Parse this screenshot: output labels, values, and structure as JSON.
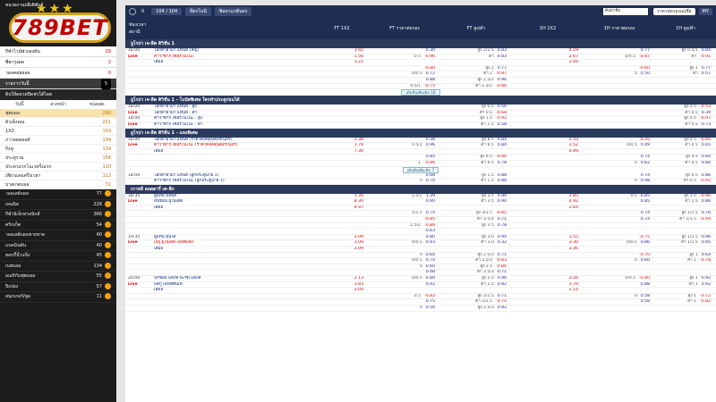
{
  "sidebar": {
    "title": "ทนวดงานปลีเติพันธ์",
    "logo_text": "789BET",
    "top_list": [
      {
        "label": "กีฬาไวน์พ่วงลงทัน",
        "count": "29"
      },
      {
        "label": "พี่พารุ่งดด",
        "count": "2"
      },
      {
        "label": "วอลคดุ่ยยอด",
        "count": "0"
      }
    ],
    "active_item": {
      "label": "รายการวันนี้",
      "badge": "5"
    },
    "section_title": "ดิบให้ดดวดปิดฟวได้ไดด",
    "sub_tabs": [
      "วันนี้",
      "ล่วงหน้า",
      "ขนดสด"
    ],
    "sports": [
      {
        "label": "ฟุตบอล",
        "count": "290"
      },
      {
        "label": "ตัวเต็งคุณ",
        "count": "221"
      },
      {
        "label": "1X2",
        "count": "159"
      },
      {
        "label": "ภาวยดดผลต์",
        "count": "134"
      },
      {
        "label": "กิ่งคู่",
        "count": "134"
      },
      {
        "label": "ประตูรวม",
        "count": "156"
      },
      {
        "label": "ประตวแรกโนเวครั้งแรก",
        "count": "110"
      },
      {
        "label": "เพียวแลนครึ่งเวลา",
        "count": "112"
      },
      {
        "label": "บาสเกตบอล",
        "count": "72"
      }
    ],
    "dark_sports": [
      {
        "label": "วอลเลย์บอล",
        "count": "77"
      },
      {
        "label": "เทนนิส",
        "count": "226"
      },
      {
        "label": "กีฬาอิเล็กทรอนิกส์",
        "count": "366"
      },
      {
        "label": "คริกเก็ต",
        "count": "54"
      },
      {
        "label": "วอลเลย์บอลชายหาด",
        "count": "40"
      },
      {
        "label": "แบดมินตัน",
        "count": "40"
      },
      {
        "label": "ฮอกกี้น้ำแข็ง",
        "count": "45"
      },
      {
        "label": "เบสบอล",
        "count": "134"
      },
      {
        "label": "อเมริกันฟุตบอล",
        "count": "55"
      },
      {
        "label": "ปิงปอง",
        "count": "57"
      },
      {
        "label": "สนุกเกอร์/พูล",
        "count": "11"
      }
    ]
  },
  "topbar": {
    "count": "0",
    "pager": "104 / 104",
    "sort_btn": "ยี่ตกโนนี",
    "view_btn": "ฟิลดาแกดีนดร",
    "search_placeholder": "ค้นหาทีม",
    "odds_select": "ราคาต่อรองเอเชีย",
    "my": "MY"
  },
  "columns": [
    "ช่องเวลา สถานี",
    "",
    "FT 1X2",
    "FT ราคาต่อรอง",
    "FT สูง/ต่ำ",
    "1H 1X2",
    "1H ราคาต่อรอง",
    "1H สูง/ต่ำ"
  ],
  "leagues": [
    {
      "name": "ยูโรปา เจ-ลีค ดิวิชั่น 1",
      "rows": [
        {
          "t": "18:00",
          "team": "โอกิตายามา แทนที่ (หญ)",
          "red": false,
          "x": "3.92",
          "ft_h": "",
          "ft_v": "0.30",
          "ou_h": "สูง 2/2.5",
          "ou_v": "0.83",
          "h1x": "4.19",
          "h1h_h": "",
          "h1h_v": "0.77",
          "h1ou_h": "สูง 0.5/1",
          "h1ou_v": "0.84"
        },
        {
          "t": "Live",
          "team": "คาวาซากิ เซอร์โนโนะ",
          "red": true,
          "x": "1.56",
          "ft_h": "0.5",
          "ft_v": "-0.96",
          "ou_h": "ต่ำ",
          "ou_v": "0.83",
          "h1x": "2.67",
          "h1h_h": "0/0.5",
          "h1h_v": "-0.87",
          "h1ou_h": "ต่ำ",
          "h1ou_v": "-0.91"
        },
        {
          "t": "",
          "team": "เสมอ",
          "red": false,
          "x": "3.22",
          "ft_h": "",
          "ft_v": "",
          "ou_h": "",
          "ou_v": "",
          "h1x": "2.04",
          "h1h_h": "",
          "h1h_v": "",
          "h1ou_h": "",
          "h1ou_v": ""
        },
        {
          "t": "",
          "team": "",
          "red": false,
          "x": "",
          "ft_h": "",
          "ft_v": "-0.80",
          "ou_h": "สูง 2",
          "ou_v": "0.77",
          "h1x": "",
          "h1h_h": "",
          "h1h_v": "-0.60",
          "h1ou_h": "สูง 1",
          "h1ou_v": "0.77"
        },
        {
          "t": "",
          "team": "",
          "red": false,
          "x": "",
          "ft_h": "0/0.5",
          "ft_v": "0.72",
          "ou_h": "ต่ำ 2",
          "ou_v": "-0.87",
          "h1x": "",
          "h1h_h": "0",
          "h1h_v": "0.50",
          "h1ou_h": "ต่ำ",
          "h1ou_v": "0.57"
        },
        {
          "t": "",
          "team": "",
          "red": false,
          "x": "",
          "ft_h": "",
          "ft_v": "0.88",
          "ou_h": "สูง 1.5/2",
          "ou_v": "0.96",
          "h1x": "",
          "h1h_h": "",
          "h1h_v": "",
          "h1ou_h": "",
          "h1ou_v": ""
        },
        {
          "t": "",
          "team": "",
          "red": false,
          "x": "",
          "ft_h": "0.5/1",
          "ft_v": "-0.75",
          "ou_h": "ต่ำ 1.5/2",
          "ou_v": "-0.86",
          "h1x": "",
          "h1h_h": "",
          "h1h_v": "",
          "h1ou_h": "",
          "h1ou_v": ""
        }
      ],
      "more": "เดิมพันเพิ่มเติม 18"
    },
    {
      "name": "ยูโรปา เจ-ลีค ดิวิชั่น 1 - โบนัสพิเศษ ใครทำประตูก่อนได้",
      "rows": [
        {
          "t": "18:00",
          "team": "โอกิตายามา แทนที่ - สูง",
          "red": false,
          "x": "",
          "ft_h": "",
          "ft_v": "",
          "ou_h": "สูง 0.5",
          "ou_v": "0.56",
          "h1x": "",
          "h1h_h": "",
          "h1h_v": "",
          "h1ou_h": "สูง 0.5",
          "h1ou_v": "-0.53"
        },
        {
          "t": "Live",
          "team": "โอกิตายามา แทนที่ - ต่ำ",
          "red": false,
          "x": "",
          "ft_h": "",
          "ft_v": "",
          "ou_h": "ต่ำ 0.5",
          "ou_v": "-0.68",
          "h1x": "",
          "h1h_h": "",
          "h1h_v": "",
          "h1ou_h": "ต่ำ 0.5",
          "h1ou_v": "0.39"
        },
        {
          "t": "18:00",
          "team": "คาวาซากิ เซอร์โนโนะ - สูง",
          "red": false,
          "x": "",
          "ft_h": "",
          "ft_v": "",
          "ou_h": "สูง 1.5",
          "ou_v": "-0.92",
          "h1x": "",
          "h1h_h": "",
          "h1h_v": "",
          "h1ou_h": "สูง 0.5",
          "h1ou_v": "-0.97"
        },
        {
          "t": "Live",
          "team": "คาวาซากิ เซอร์โนโนะ - ต่ำ",
          "red": false,
          "x": "",
          "ft_h": "",
          "ft_v": "",
          "ou_h": "ต่ำ 1.5",
          "ou_v": "0.58",
          "h1x": "",
          "h1h_h": "",
          "h1h_v": "",
          "h1ou_h": "ต่ำ 0.5",
          "h1ou_v": "0.73"
        }
      ],
      "more": ""
    },
    {
      "name": "ยูโรปา เจ-ลีค ดิวิชั่น 1 - แทงพิเศษ",
      "rows": [
        {
          "t": "18:00",
          "team": "โอกิตายามา แทนที่ (ราคาคอดดุนคอร์เนอร์)",
          "red": false,
          "x": "2.38",
          "ft_h": "",
          "ft_v": "0.38",
          "ou_h": "สูง 8.5",
          "ou_v": "0.84",
          "h1x": "2.33",
          "h1h_h": "",
          "h1h_v": "-0.35",
          "h1ou_h": "สูง 0.5",
          "h1ou_v": "-0.85"
        },
        {
          "t": "Live",
          "team": "คาวาซากิ เซอร์โนโนะ (ราคาคอดดุนคอร์เนอร์)",
          "red": true,
          "x": "1.79",
          "ft_h": "0.5/1",
          "ft_v": "0.96",
          "ou_h": "ต่ำ 8.5",
          "ou_v": "0.84",
          "h1x": "2.52",
          "h1h_h": "0/0.5",
          "h1h_v": "0.49",
          "h1ou_h": "ต่ำ 0.5",
          "h1ou_v": "0.65"
        },
        {
          "t": "",
          "team": "เสมอ",
          "red": false,
          "x": "7.30",
          "ft_h": "",
          "ft_v": "",
          "ou_h": "",
          "ou_v": "",
          "h1x": "4.89",
          "h1h_h": "",
          "h1h_v": "",
          "h1ou_h": "",
          "h1ou_v": ""
        },
        {
          "t": "",
          "team": "",
          "red": false,
          "x": "",
          "ft_h": "",
          "ft_v": "0.85",
          "ou_h": "สูง 8.5",
          "ou_v": "-0.96",
          "h1x": "",
          "h1h_h": "",
          "h1h_v": "0.74",
          "h1ou_h": "สูง 4.5",
          "h1ou_v": "0.84"
        },
        {
          "t": "",
          "team": "",
          "red": false,
          "x": "",
          "ft_h": "1",
          "ft_v": "-0.96",
          "ou_h": "ต่ำ 9.5",
          "ou_v": "0.78",
          "h1x": "",
          "h1h_h": "0",
          "h1h_v": "0.62",
          "h1ou_h": "ต่ำ 4.5",
          "h1ou_v": "0.84"
        }
      ],
      "more": "เดิมพันเพิ่มเติม 7"
    },
    {
      "name": "",
      "rows": [
        {
          "t": "18:00",
          "team": "โอกิตายามา แทนที่ (ลูกประตูนาย 1)",
          "red": false,
          "x": "",
          "ft_h": "",
          "ft_v": "0.68",
          "ou_h": "สูง 1.5",
          "ou_v": "0.88",
          "h1x": "",
          "h1h_h": "",
          "h1h_v": "0.74",
          "h1ou_h": "สูง 0.5",
          "h1ou_v": "0.86"
        },
        {
          "t": "",
          "team": "คาวาซากิ เซอร์โนโนะ (ลูกประตูนาย 1)",
          "red": false,
          "x": "",
          "ft_h": "0",
          "ft_v": "0.70",
          "ou_h": "ต่ำ 1.5",
          "ou_v": "0.88",
          "h1x": "",
          "h1h_h": "0",
          "h1h_v": "0.98",
          "h1ou_h": "ต่ำ 0.5",
          "h1ou_v": "-0.92"
        }
      ],
      "more": ""
    },
    {
      "name": "เกาหลี ลอตตารี่ เค-ลีก",
      "rows": [
        {
          "t": "18:35",
          "team": "ยูแทน มอพส์",
          "red": false,
          "x": "1.34",
          "ft_h": "1.5/2",
          "ft_v": "1.39",
          "ou_h": "สูง 3.5",
          "ou_v": "0.90",
          "h1x": "1.85",
          "h1h_h": "0.5",
          "h1h_v": "0.85",
          "h1ou_h": "สูง 1.5",
          "h1ou_v": "-0.96"
        },
        {
          "t": "Live",
          "team": "อินชอน ยูไนเต็ด",
          "red": false,
          "x": "8.30",
          "ft_h": "",
          "ft_v": "0.90",
          "ou_h": "ต่ำ 3.5",
          "ou_v": "0.90",
          "h1x": "4.92",
          "h1h_h": "",
          "h1h_v": "0.85",
          "h1ou_h": "ต่ำ 1.5",
          "h1ou_v": "0.86"
        },
        {
          "t": "",
          "team": "เสมอ",
          "red": false,
          "x": "4.97",
          "ft_h": "",
          "ft_v": "",
          "ou_h": "",
          "ou_v": "",
          "h1x": "2.64",
          "h1h_h": "",
          "h1h_v": "",
          "h1ou_h": "",
          "h1ou_v": ""
        },
        {
          "t": "",
          "team": "",
          "red": false,
          "x": "",
          "ft_h": "1/1.5",
          "ft_v": "0.74",
          "ou_h": "สูง 3/3.5",
          "ou_v": "-0.85",
          "h1x": "",
          "h1h_h": "",
          "h1h_v": "0.74",
          "h1ou_h": "สูง 1/1.5",
          "h1ou_v": "0.76"
        },
        {
          "t": "",
          "team": "",
          "red": false,
          "x": "",
          "ft_h": "",
          "ft_v": "-0.85",
          "ou_h": "ต่ำ 3.5/4",
          "ou_v": "0.71",
          "h1x": "",
          "h1h_h": "",
          "h1h_v": "0.74",
          "h1ou_h": "ต่ำ 1/1.5",
          "h1ou_v": "-0.94"
        },
        {
          "t": "",
          "team": "",
          "red": false,
          "x": "",
          "ft_h": "1.5/2",
          "ft_v": "-0.89",
          "ou_h": "สูง 3.5",
          "ou_v": "0.78",
          "h1x": "",
          "h1h_h": "",
          "h1h_v": "",
          "h1ou_h": "",
          "h1ou_v": ""
        },
        {
          "t": "",
          "team": "",
          "red": false,
          "x": "",
          "ft_h": "",
          "ft_v": "0.63",
          "ou_h": "",
          "ou_v": "",
          "h1x": "",
          "h1h_h": "",
          "h1h_v": "",
          "h1ou_h": "",
          "h1ou_v": ""
        },
        {
          "t": "19:35",
          "team": "ยูแทน ฮุนได",
          "red": false,
          "x": "3.09",
          "ft_h": "",
          "ft_v": "0.80",
          "ou_h": "สูง 3.0",
          "ou_v": "0.94",
          "h1x": "3.55",
          "h1h_h": "",
          "h1h_v": "-0.75",
          "h1ou_h": "สูง 1/1.5",
          "h1ou_v": "0.96"
        },
        {
          "t": "Live",
          "team": "เจจู ยูไนเต็ด เอฟซีแดง",
          "red": true,
          "x": "3.09",
          "ft_h": "0/0.5",
          "ft_v": "0.93",
          "ou_h": "ต่ำ 3.0",
          "ou_v": "0.32",
          "h1x": "3.30",
          "h1h_h": "0/0.5",
          "h1h_v": "0.86",
          "h1ou_h": "ต่ำ 1/1.5",
          "h1ou_v": "0.85"
        },
        {
          "t": "",
          "team": "เสมอ",
          "red": false,
          "x": "3.09",
          "ft_h": "",
          "ft_v": "",
          "ou_h": "",
          "ou_v": "",
          "h1x": "2.36",
          "h1h_h": "",
          "h1h_v": "",
          "h1ou_h": "",
          "h1ou_v": ""
        },
        {
          "t": "",
          "team": "",
          "red": false,
          "x": "",
          "ft_h": "0",
          "ft_v": "0.60",
          "ou_h": "สูง 2.5/3",
          "ou_v": "0.71",
          "h1x": "",
          "h1h_h": "",
          "h1h_v": "-0.70",
          "h1ou_h": "สูง 1",
          "h1ou_v": "0.64"
        },
        {
          "t": "",
          "team": "",
          "red": false,
          "x": "",
          "ft_h": "0/0.5",
          "ft_v": "0.74",
          "ou_h": "ต่ำ 2.5/3",
          "ou_v": "-0.83",
          "h1x": "",
          "h1h_h": "0",
          "h1h_v": "0.60",
          "h1ou_h": "ต่ำ 1",
          "h1ou_v": "-0.78"
        },
        {
          "t": "",
          "team": "",
          "red": false,
          "x": "",
          "ft_h": "0",
          "ft_v": "0.60",
          "ou_h": "สูง 2.5",
          "ou_v": "-0.86",
          "h1x": "",
          "h1h_h": "",
          "h1h_v": "",
          "h1ou_h": "",
          "h1ou_v": ""
        },
        {
          "t": "",
          "team": "",
          "red": false,
          "x": "",
          "ft_h": "",
          "ft_v": "0.48",
          "ou_h": "ต่ำ 3.5/3",
          "ou_v": "0.71",
          "h1x": "",
          "h1h_h": "",
          "h1h_v": "",
          "h1ou_h": "",
          "h1ou_v": ""
        },
        {
          "t": "20:00",
          "team": "ปีกซอม แดงที่ พะรัด แดงที่",
          "red": false,
          "x": "2.13",
          "ft_h": "0/0.5",
          "ft_v": "0.80",
          "ou_h": "สูง 2.5",
          "ou_v": "0.96",
          "h1x": "2.56",
          "h1h_h": "0/0.5",
          "h1h_v": "-0.80",
          "h1ou_h": "สูง 1",
          "h1ou_v": "0.92"
        },
        {
          "t": "Live",
          "team": "แดกู เอฟซีซันเด้",
          "red": false,
          "x": "3.83",
          "ft_h": "",
          "ft_v": "0.92",
          "ou_h": "ต่ำ 2.5",
          "ou_v": "0.92",
          "h1x": "3.79",
          "h1h_h": "",
          "h1h_v": "0.88",
          "h1ou_h": "ต่ำ 1",
          "h1ou_v": "0.92"
        },
        {
          "t": "",
          "team": "เสมอ",
          "red": false,
          "x": "3.04",
          "ft_h": "",
          "ft_v": "",
          "ou_h": "",
          "ou_v": "",
          "h1x": "2.14",
          "h1h_h": "",
          "h1h_v": "",
          "h1ou_h": "",
          "h1ou_v": ""
        },
        {
          "t": "",
          "team": "",
          "red": false,
          "x": "",
          "ft_h": "0.5",
          "ft_v": "-0.82",
          "ou_h": "สูง 2/2.5",
          "ou_v": "0.71",
          "h1x": "",
          "h1h_h": "0",
          "h1h_v": "0.58",
          "h1ou_h": "สูง 1",
          "h1ou_v": "-0.72"
        },
        {
          "t": "",
          "team": "",
          "red": false,
          "x": "",
          "ft_h": "",
          "ft_v": "0.75",
          "ou_h": "ต่ำ 2/2.5",
          "ou_v": "-0.75",
          "h1x": "",
          "h1h_h": "",
          "h1h_v": "0.58",
          "h1ou_h": "ต่ำ 1",
          "h1ou_v": "-0.82"
        },
        {
          "t": "",
          "team": "",
          "red": false,
          "x": "",
          "ft_h": "0",
          "ft_v": "0.50",
          "ou_h": "สูง 2.5/3",
          "ou_v": "0.82",
          "h1x": "",
          "h1h_h": "",
          "h1h_v": "",
          "h1ou_h": "",
          "h1ou_v": ""
        }
      ],
      "more": ""
    }
  ]
}
